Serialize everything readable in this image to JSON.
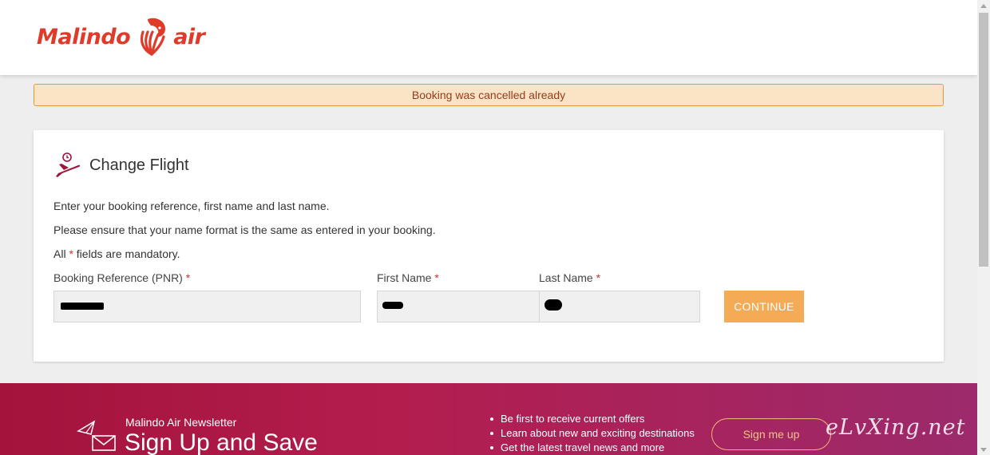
{
  "header": {
    "logo_left": "Malindo",
    "logo_right": "air",
    "logo_icon": "lion-head-icon"
  },
  "alert": {
    "message": "Booking was cancelled already"
  },
  "card": {
    "title": "Change Flight",
    "title_icon": "plane-clock-icon",
    "line1": "Enter your booking reference, first name and last name.",
    "line2": "Please ensure that your name format is the same as entered in your booking.",
    "mandatory_prefix": "All",
    "mandatory_star": "*",
    "mandatory_suffix": "fields are mandatory.",
    "fields": [
      {
        "label": "Booking Reference (PNR)",
        "required": "*"
      },
      {
        "label": "First Name",
        "required": "*"
      },
      {
        "label": "Last Name",
        "required": "*"
      }
    ],
    "continue_label": "CONTINUE"
  },
  "footer": {
    "newsletter_small": "Malindo Air Newsletter",
    "newsletter_big": "Sign Up and Save",
    "bullets": [
      "Be first to receive current offers",
      "Learn about new and exciting destinations",
      "Get the latest travel news and more"
    ],
    "signup_label": "Sign me up",
    "watermark": "eLvXing.net"
  },
  "colors": {
    "brand_red": "#e03b2a",
    "alert_bg": "#fbe3c6",
    "alert_border": "#e09a3e",
    "button_orange": "#f5aa56",
    "footer_magenta": "#a3133b"
  }
}
